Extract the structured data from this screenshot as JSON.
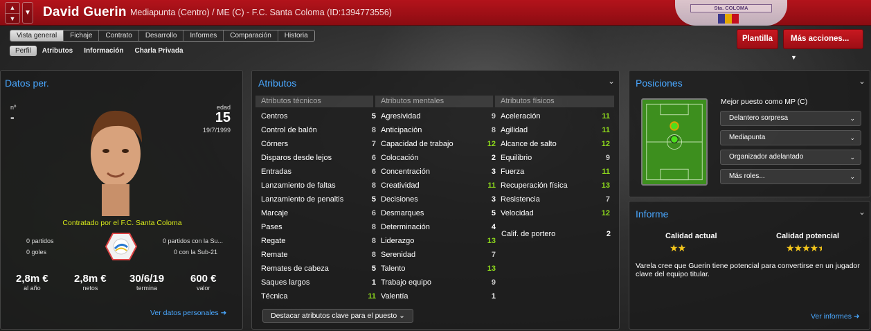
{
  "header": {
    "name": "David Guerin",
    "description": "Mediapunta (Centro) / ME (C) - F.C. Santa Coloma (ID:1394773556)",
    "crest_text": "Sta. COLOMA"
  },
  "tabs": [
    "Vista general",
    "Fichaje",
    "Contrato",
    "Desarrollo",
    "Informes",
    "Comparación",
    "Historia"
  ],
  "subtabs": [
    "Perfil",
    "Atributos",
    "Información",
    "Charla Privada"
  ],
  "buttons": {
    "plantilla": "Plantilla",
    "mas_acciones": "Más acciones..."
  },
  "datos": {
    "title": "Datos per.",
    "num_label": "nº",
    "num": "-",
    "edad_label": "edad",
    "edad": "15",
    "dob": "19/7/1999",
    "contract": "Contratado por el F.C. Santa Coloma",
    "left1": "0 partidos",
    "left2": "0 goles",
    "right1": "0 partidos con la Su...",
    "right2": "0 con la Sub-21",
    "money": [
      {
        "v": "2,8m €",
        "l": "al año"
      },
      {
        "v": "2,8m €",
        "l": "netos"
      },
      {
        "v": "30/6/19",
        "l": "termina"
      },
      {
        "v": "600 €",
        "l": "valor"
      }
    ],
    "link": "Ver datos personales"
  },
  "atributos": {
    "title": "Atributos",
    "h_tec": "Atributos técnicos",
    "h_men": "Atributos mentales",
    "h_fis": "Atributos físicos",
    "tec": [
      [
        "Centros",
        "5"
      ],
      [
        "Control de balón",
        "8"
      ],
      [
        "Córners",
        "7"
      ],
      [
        "Disparos desde lejos",
        "6"
      ],
      [
        "Entradas",
        "6"
      ],
      [
        "Lanzamiento de faltas",
        "8"
      ],
      [
        "Lanzamiento de penaltis",
        "5"
      ],
      [
        "Marcaje",
        "6"
      ],
      [
        "Pases",
        "8"
      ],
      [
        "Regate",
        "8"
      ],
      [
        "Remate",
        "8"
      ],
      [
        "Remates de cabeza",
        "5"
      ],
      [
        "Saques largos",
        "1"
      ],
      [
        "Técnica",
        "11"
      ]
    ],
    "men": [
      [
        "Agresividad",
        "9"
      ],
      [
        "Anticipación",
        "8"
      ],
      [
        "Capacidad de trabajo",
        "12"
      ],
      [
        "Colocación",
        "2"
      ],
      [
        "Concentración",
        "3"
      ],
      [
        "Creatividad",
        "11"
      ],
      [
        "Decisiones",
        "3"
      ],
      [
        "Desmarques",
        "5"
      ],
      [
        "Determinación",
        "4"
      ],
      [
        "Liderazgo",
        "13"
      ],
      [
        "Serenidad",
        "7"
      ],
      [
        "Talento",
        "13"
      ],
      [
        "Trabajo equipo",
        "9"
      ],
      [
        "Valentía",
        "1"
      ]
    ],
    "fis": [
      [
        "Aceleración",
        "11"
      ],
      [
        "Agilidad",
        "11"
      ],
      [
        "Alcance de salto",
        "12"
      ],
      [
        "Equilibrio",
        "9"
      ],
      [
        "Fuerza",
        "11"
      ],
      [
        "Recuperación física",
        "13"
      ],
      [
        "Resistencia",
        "7"
      ],
      [
        "Velocidad",
        "12"
      ]
    ],
    "gk_label": "Calif. de portero",
    "gk_value": "2",
    "highlight": "Destacar atributos clave para el puesto"
  },
  "posiciones": {
    "title": "Posiciones",
    "best": "Mejor puesto como MP (C)",
    "roles": [
      "Delantero sorpresa",
      "Mediapunta",
      "Organizador adelantado",
      "Más roles..."
    ]
  },
  "informe": {
    "title": "Informe",
    "actual_label": "Calidad actual",
    "potencial_label": "Calidad potencial",
    "actual_stars": 2,
    "potencial_stars": 4.5,
    "text": "Varela cree que Guerin tiene potencial para convertirse en un jugador clave del equipo titular.",
    "link": "Ver informes"
  }
}
